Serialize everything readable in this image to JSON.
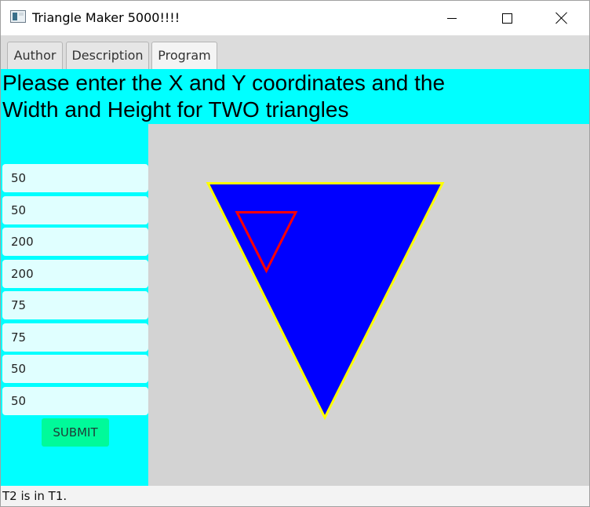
{
  "window": {
    "title": "Triangle Maker 5000!!!!",
    "icon": "app-window-icon"
  },
  "tabs": [
    {
      "label": "Author"
    },
    {
      "label": "Description"
    },
    {
      "label": "Program",
      "selected": true
    }
  ],
  "instructions": "Please enter the X and Y coordinates and the Width and Height for TWO triangles",
  "fields": [
    "50",
    "50",
    "200",
    "200",
    "75",
    "75",
    "50",
    "50"
  ],
  "submit_label": "SUBMIT",
  "status": "T2 is in T1.",
  "colors": {
    "panel_background": "#00ffff",
    "field_background": "#e0ffff",
    "canvas_background": "#d3d3d3",
    "submit_background": "#00fa9a",
    "t1_fill": "#0000ff",
    "t1_stroke": "#ffff00",
    "t2_stroke": "#ff0000"
  }
}
